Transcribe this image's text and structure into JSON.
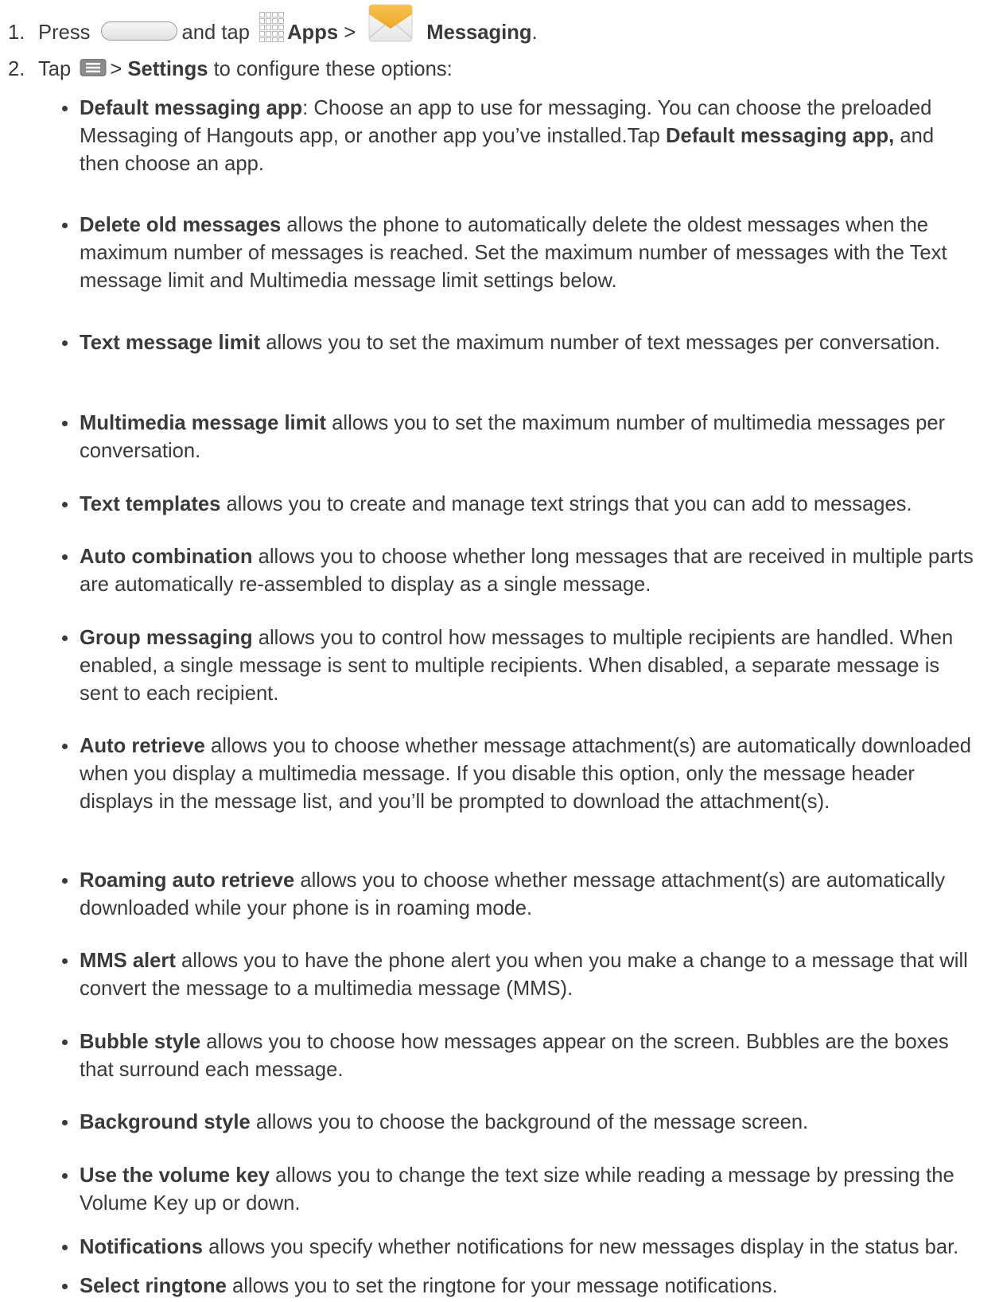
{
  "steps": [
    {
      "number": "1.",
      "press": "Press",
      "and_tap": "and tap",
      "apps_label": "Apps",
      "separator": ">",
      "messaging_label": "Messaging",
      "end": "."
    },
    {
      "number": "2.",
      "tap": "Tap",
      "separator": ">",
      "settings_label": "Settings",
      "rest": "to configure these options:"
    }
  ],
  "options": [
    {
      "name": "Default messaging app",
      "text": ": Choose an app to use for messaging. You can choose the preloaded Messaging of Hangouts app, or another app you’ve installed.Tap ",
      "name2": "Default messaging app,",
      "text2": " and then choose an app."
    },
    {
      "name": "Delete old messages",
      "text": " allows the phone to automatically delete the oldest messages when the maximum number of messages is reached. Set the maximum number of messages with the Text message limit and Multimedia message limit settings below."
    },
    {
      "name": "Text message limit",
      "text": " allows you to set the maximum number of text messages per conversation."
    },
    {
      "name": "Multimedia message limit",
      "text": " allows you to set the maximum number of multimedia messages per conversation."
    },
    {
      "name": "Text templates",
      "text": " allows you to create and manage text strings that you can add to messages."
    },
    {
      "name": "Auto combination",
      "text": " allows you to choose whether long messages that are received in multiple parts are automatically re-assembled to display as a single message."
    },
    {
      "name": "Group messaging",
      "text": " allows you to control how messages to multiple recipients are handled. When enabled, a single message is sent to multiple recipients. When disabled, a separate message is sent to each recipient."
    },
    {
      "name": "Auto retrieve",
      "text": " allows you to choose whether message attachment(s) are automatically downloaded when you display a multimedia message. If you disable this option, only the message header displays in the message list, and you’ll be prompted to download the attachment(s)."
    },
    {
      "name": "Roaming auto retrieve",
      "text": " allows you to choose whether message attachment(s) are automatically downloaded while your phone is in roaming mode."
    },
    {
      "name": "MMS alert",
      "text": " allows you to have the phone alert you when you make a change to a message that will convert the message to a multimedia message (MMS)."
    },
    {
      "name": "Bubble style",
      "text": " allows you to choose how messages appear on the screen. Bubbles are the boxes that surround each message."
    },
    {
      "name": "Background style",
      "text": " allows you to choose the background of the message screen."
    },
    {
      "name": "Use the volume key",
      "text": " allows you to change the text size while reading a message by pressing the Volume Key up or down."
    },
    {
      "name": "Notifications",
      "text": " allows you specify whether notifications for new messages display in the status bar."
    },
    {
      "name": "Select ringtone",
      "text": " allows you to set the ringtone for your message notifications."
    }
  ],
  "icons": {
    "home_key": "home-key-icon",
    "apps": "apps-grid-icon",
    "messaging": "messaging-envelope-icon",
    "menu": "menu-key-icon"
  },
  "colors": {
    "text": "#3a3a3a",
    "messaging_icon": "#f2b43a"
  }
}
